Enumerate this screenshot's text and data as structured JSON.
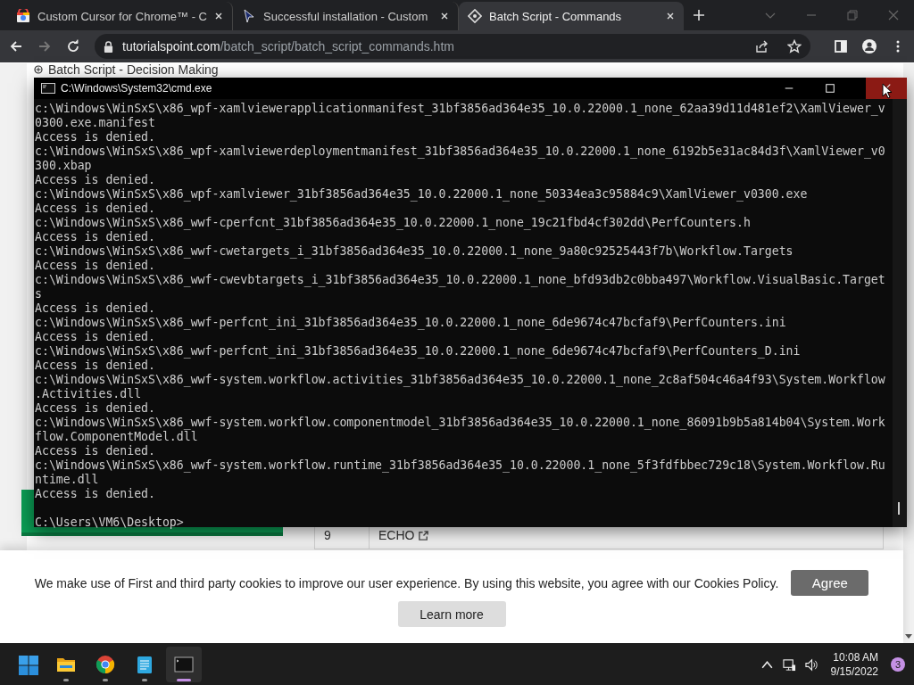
{
  "browser": {
    "tabs": [
      {
        "title": "Custom Cursor for Chrome™ - C",
        "selected": false
      },
      {
        "title": "Successful installation - Custom",
        "selected": false
      },
      {
        "title": "Batch Script - Commands",
        "selected": true
      }
    ],
    "nav": {
      "forward_disabled": true
    },
    "address": {
      "domain": "tutorialspoint.com",
      "path": "/batch_script/batch_script_commands.htm"
    }
  },
  "page": {
    "sidebar_link": "Batch Script - Decision Making",
    "table_row": {
      "number": "9",
      "command": "ECHO"
    },
    "cookie_banner": {
      "text": "We make use of First and third party cookies to improve our user experience. By using this website, you agree with our Cookies Policy.",
      "agree": "Agree",
      "learn_more": "Learn more"
    }
  },
  "console": {
    "title": "C:\\Windows\\System32\\cmd.exe",
    "lines": [
      "c:\\Windows\\WinSxS\\x86_wpf-xamlviewerapplicationmanifest_31bf3856ad364e35_10.0.22000.1_none_62aa39d11d481ef2\\XamlViewer_v",
      "0300.exe.manifest",
      "Access is denied.",
      "c:\\Windows\\WinSxS\\x86_wpf-xamlviewerdeploymentmanifest_31bf3856ad364e35_10.0.22000.1_none_6192b5e31ac84d3f\\XamlViewer_v0",
      "300.xbap",
      "Access is denied.",
      "c:\\Windows\\WinSxS\\x86_wpf-xamlviewer_31bf3856ad364e35_10.0.22000.1_none_50334ea3c95884c9\\XamlViewer_v0300.exe",
      "Access is denied.",
      "c:\\Windows\\WinSxS\\x86_wwf-cperfcnt_31bf3856ad364e35_10.0.22000.1_none_19c21fbd4cf302dd\\PerfCounters.h",
      "Access is denied.",
      "c:\\Windows\\WinSxS\\x86_wwf-cwetargets_i_31bf3856ad364e35_10.0.22000.1_none_9a80c92525443f7b\\Workflow.Targets",
      "Access is denied.",
      "c:\\Windows\\WinSxS\\x86_wwf-cwevbtargets_i_31bf3856ad364e35_10.0.22000.1_none_bfd93db2c0bba497\\Workflow.VisualBasic.Target",
      "s",
      "Access is denied.",
      "c:\\Windows\\WinSxS\\x86_wwf-perfcnt_ini_31bf3856ad364e35_10.0.22000.1_none_6de9674c47bcfaf9\\PerfCounters.ini",
      "Access is denied.",
      "c:\\Windows\\WinSxS\\x86_wwf-perfcnt_ini_31bf3856ad364e35_10.0.22000.1_none_6de9674c47bcfaf9\\PerfCounters_D.ini",
      "Access is denied.",
      "c:\\Windows\\WinSxS\\x86_wwf-system.workflow.activities_31bf3856ad364e35_10.0.22000.1_none_2c8af504c46a4f93\\System.Workflow",
      ".Activities.dll",
      "Access is denied.",
      "c:\\Windows\\WinSxS\\x86_wwf-system.workflow.componentmodel_31bf3856ad364e35_10.0.22000.1_none_86091b9b5a814b04\\System.Work",
      "flow.ComponentModel.dll",
      "Access is denied.",
      "c:\\Windows\\WinSxS\\x86_wwf-system.workflow.runtime_31bf3856ad364e35_10.0.22000.1_none_5f3fdfbbec729c18\\System.Workflow.Ru",
      "ntime.dll",
      "Access is denied."
    ],
    "prompt": "C:\\Users\\VM6\\Desktop>"
  },
  "taskbar": {
    "apps": [
      {
        "selected": false
      },
      {
        "selected": false
      },
      {
        "selected": false
      },
      {
        "selected": true
      }
    ],
    "time": "10:08 AM",
    "date": "9/15/2022",
    "notifications": "3"
  }
}
